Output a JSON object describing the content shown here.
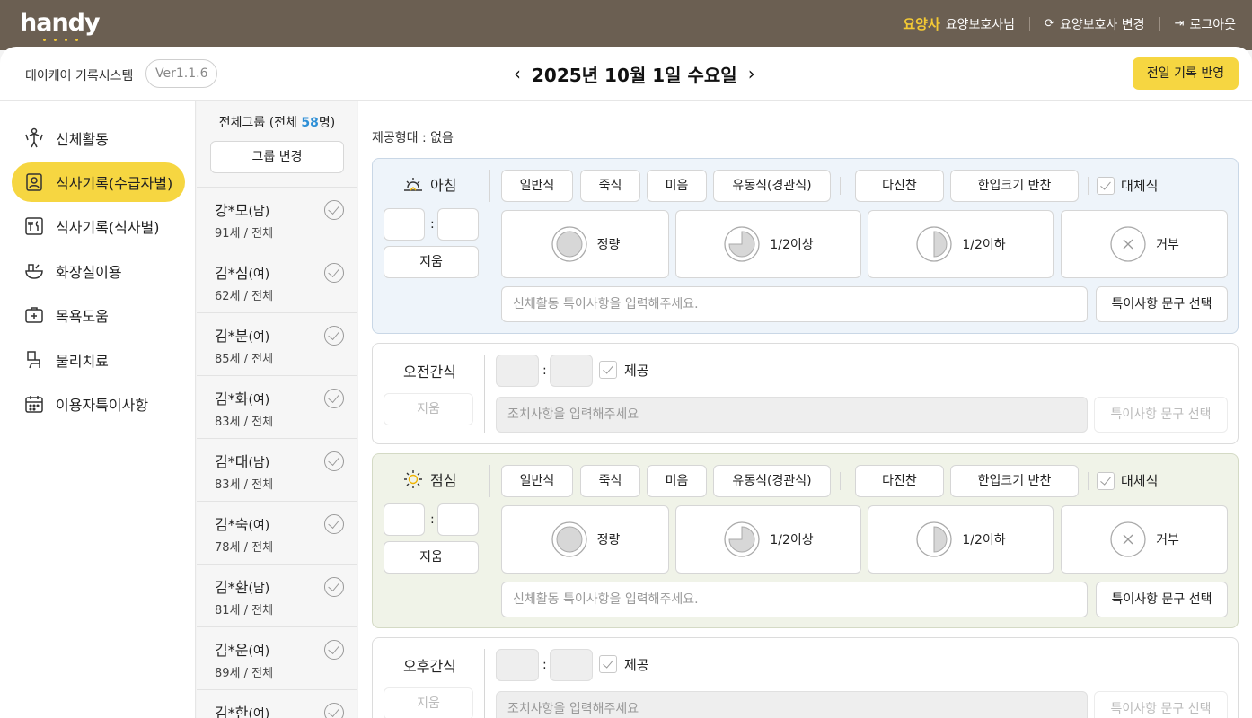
{
  "app": {
    "logo": "handy"
  },
  "topbar": {
    "role": "요양사",
    "user": "요양보호사님",
    "switch_label": "요양보호사 변경",
    "logout_label": "로그아웃"
  },
  "header": {
    "system_name": "데이케어 기록시스템",
    "version": "Ver1.1.6",
    "date": "2025년 10월 1일 수요일",
    "prev_record_button": "전일 기록 반영"
  },
  "sidebar": {
    "items": [
      {
        "label": "신체활동",
        "icon": "body-activity-icon"
      },
      {
        "label": "식사기록(수급자별)",
        "icon": "recipient-card-icon",
        "active": true
      },
      {
        "label": "식사기록(식사별)",
        "icon": "meal-menu-icon"
      },
      {
        "label": "화장실이용",
        "icon": "toilet-icon"
      },
      {
        "label": "목욕도움",
        "icon": "bath-kit-icon"
      },
      {
        "label": "물리치료",
        "icon": "therapy-icon"
      },
      {
        "label": "이용자특이사항",
        "icon": "calendar-icon"
      }
    ]
  },
  "people": {
    "title_prefix": "전체그룹 (전체 ",
    "count": "58",
    "title_suffix": "명)",
    "group_button": "그룹 변경",
    "list": [
      {
        "name": "강*모",
        "sex": "(남)",
        "info": "91세 / 전체"
      },
      {
        "name": "김*심",
        "sex": "(여)",
        "info": "62세 / 전체"
      },
      {
        "name": "김*분",
        "sex": "(여)",
        "info": "85세 / 전체"
      },
      {
        "name": "김*화",
        "sex": "(여)",
        "info": "83세 / 전체"
      },
      {
        "name": "김*대",
        "sex": "(남)",
        "info": "83세 / 전체"
      },
      {
        "name": "김*숙",
        "sex": "(여)",
        "info": "78세 / 전체"
      },
      {
        "name": "김*환",
        "sex": "(남)",
        "info": "81세 / 전체"
      },
      {
        "name": "김*운",
        "sex": "(여)",
        "info": "89세 / 전체"
      },
      {
        "name": "김*한",
        "sex": "(여)",
        "info": ""
      }
    ]
  },
  "main": {
    "provide_type": "제공형태 : 없음",
    "colon": ":",
    "morning": {
      "name": "아침",
      "delete": "지움",
      "tags": [
        "일반식",
        "죽식",
        "미음",
        "유동식(경관식)",
        "다진찬",
        "한입크기 반찬"
      ],
      "substitute": "대체식",
      "amounts": [
        "정량",
        "1/2이상",
        "1/2이하",
        "거부"
      ],
      "note_placeholder": "신체활동 특이사항을 입력해주세요.",
      "select_phrase": "특이사항 문구 선택"
    },
    "am_snack": {
      "name": "오전간식",
      "delete": "지움",
      "provided": "제공",
      "note_placeholder": "조치사항을 입력해주세요",
      "select_phrase": "특이사항 문구 선택"
    },
    "lunch": {
      "name": "점심",
      "delete": "지움",
      "tags": [
        "일반식",
        "죽식",
        "미음",
        "유동식(경관식)",
        "다진찬",
        "한입크기 반찬"
      ],
      "substitute": "대체식",
      "amounts": [
        "정량",
        "1/2이상",
        "1/2이하",
        "거부"
      ],
      "note_placeholder": "신체활동 특이사항을 입력해주세요.",
      "select_phrase": "특이사항 문구 선택"
    },
    "pm_snack": {
      "name": "오후간식",
      "delete": "지움",
      "provided": "제공",
      "note_placeholder": "조치사항을 입력해주세요",
      "select_phrase": "특이사항 문구 선택"
    }
  },
  "colors": {
    "accent": "#f6d641",
    "topbar": "#6b5f52",
    "count": "#2e8fd6"
  }
}
